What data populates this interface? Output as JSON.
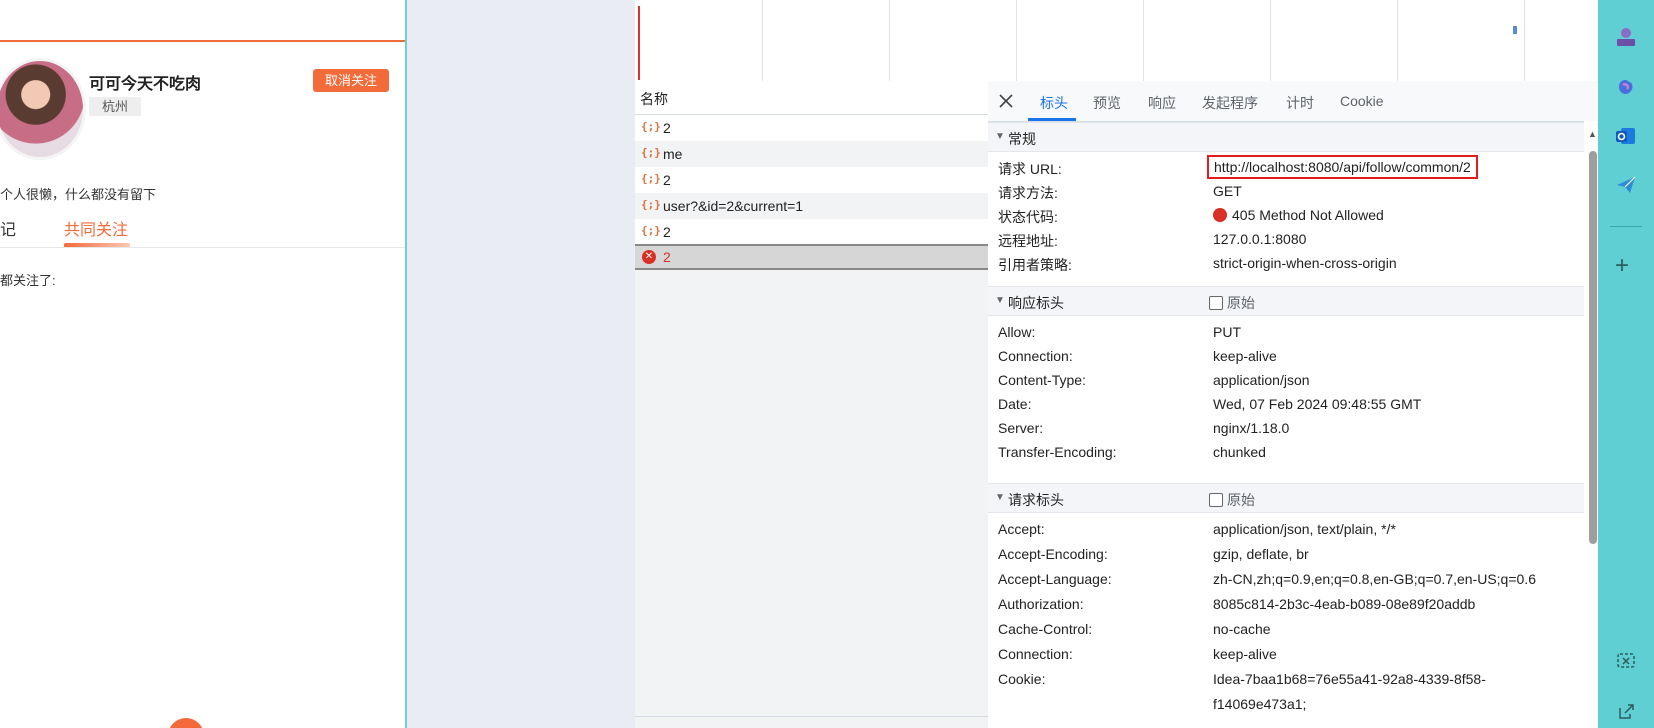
{
  "app": {
    "username": "可可今天不吃肉",
    "city": "杭州",
    "unfollow_label": "取消关注",
    "bio": "个人很懒，什么都没有留下",
    "tabs": [
      "记",
      "共同关注"
    ],
    "followed_label": "都关注了:",
    "accent": "#f46b3a"
  },
  "network": {
    "list_header": "名称",
    "requests": [
      {
        "icon": "{;}",
        "name": "2"
      },
      {
        "icon": "{;}",
        "name": "me"
      },
      {
        "icon": "{;}",
        "name": "2"
      },
      {
        "icon": "{;}",
        "name": "user?&id=2&current=1"
      },
      {
        "icon": "{;}",
        "name": "2"
      },
      {
        "icon": "error-icon",
        "name": "2",
        "selected": true,
        "error": true
      }
    ]
  },
  "detail": {
    "tabs": [
      "标头",
      "预览",
      "响应",
      "发起程序",
      "计时",
      "Cookie"
    ],
    "active_tab": "标头",
    "general": {
      "title": "常规",
      "rows": [
        {
          "k": "请求 URL:",
          "v": "http://localhost:8080/api/follow/common/2"
        },
        {
          "k": "请求方法:",
          "v": "GET"
        },
        {
          "k": "状态代码:",
          "v": "405 Method Not Allowed"
        },
        {
          "k": "远程地址:",
          "v": "127.0.0.1:8080"
        },
        {
          "k": "引用者策略:",
          "v": "strict-origin-when-cross-origin"
        }
      ]
    },
    "response_headers": {
      "title": "响应标头",
      "raw_label": "原始",
      "rows": [
        {
          "k": "Allow:",
          "v": "PUT"
        },
        {
          "k": "Connection:",
          "v": "keep-alive"
        },
        {
          "k": "Content-Type:",
          "v": "application/json"
        },
        {
          "k": "Date:",
          "v": "Wed, 07 Feb 2024 09:48:55 GMT"
        },
        {
          "k": "Server:",
          "v": "nginx/1.18.0"
        },
        {
          "k": "Transfer-Encoding:",
          "v": "chunked"
        }
      ]
    },
    "request_headers": {
      "title": "请求标头",
      "raw_label": "原始",
      "rows": [
        {
          "k": "Accept:",
          "v": "application/json, text/plain, */*"
        },
        {
          "k": "Accept-Encoding:",
          "v": "gzip, deflate, br"
        },
        {
          "k": "Accept-Language:",
          "v": "zh-CN,zh;q=0.9,en;q=0.8,en-GB;q=0.7,en-US;q=0.6"
        },
        {
          "k": "Authorization:",
          "v": "8085c814-2b3c-4eab-b089-08e89f20addb"
        },
        {
          "k": "Cache-Control:",
          "v": "no-cache"
        },
        {
          "k": "Connection:",
          "v": "keep-alive"
        },
        {
          "k": "Cookie:",
          "v": "Idea-7baa1b68=76e55a41-92a8-4339-8f58-"
        },
        {
          "k": "",
          "v": "f14069e473a1;"
        }
      ]
    }
  },
  "sidebar_icons": [
    "chess-icon",
    "copilot-icon",
    "outlook-icon",
    "telegram-icon",
    "plus-icon",
    "screenshot-icon",
    "external-link-icon"
  ]
}
